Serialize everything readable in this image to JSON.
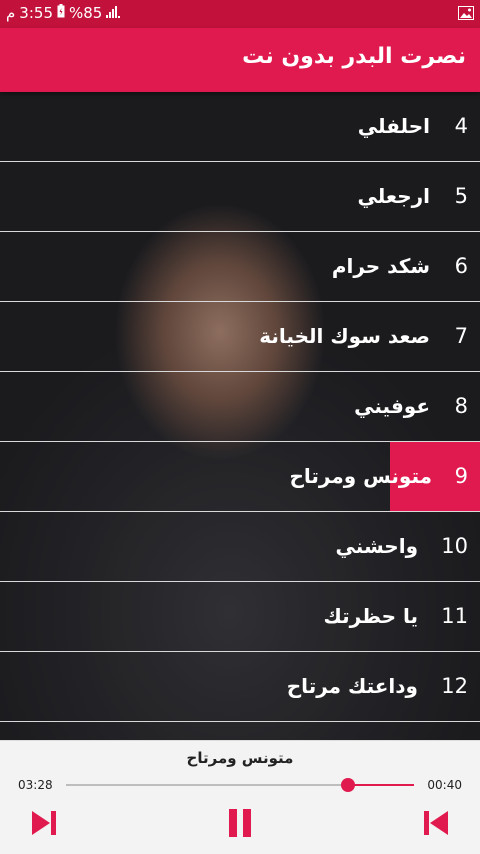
{
  "status_bar": {
    "time": "3:55",
    "period": "م",
    "battery": "%85"
  },
  "app_bar": {
    "title": "نصرت البدر بدون نت"
  },
  "songs": [
    {
      "num": "4",
      "name": "احلفلي"
    },
    {
      "num": "5",
      "name": "ارجعلي"
    },
    {
      "num": "6",
      "name": "شكد حرام"
    },
    {
      "num": "7",
      "name": "صعد سوك الخيانة"
    },
    {
      "num": "8",
      "name": "عوفيني"
    },
    {
      "num": "9",
      "name": "متونس ومرتاح"
    },
    {
      "num": "10",
      "name": "واحشني"
    },
    {
      "num": "11",
      "name": "يا حظرتك"
    },
    {
      "num": "12",
      "name": "وداعتك مرتاح"
    }
  ],
  "player": {
    "now_playing": "متونس ومرتاح",
    "elapsed": "00:40",
    "duration": "03:28",
    "progress_fraction": 0.19,
    "accent_color": "#e01a4f",
    "controls": [
      "skip-next-icon",
      "pause-icon",
      "skip-previous-icon"
    ]
  }
}
